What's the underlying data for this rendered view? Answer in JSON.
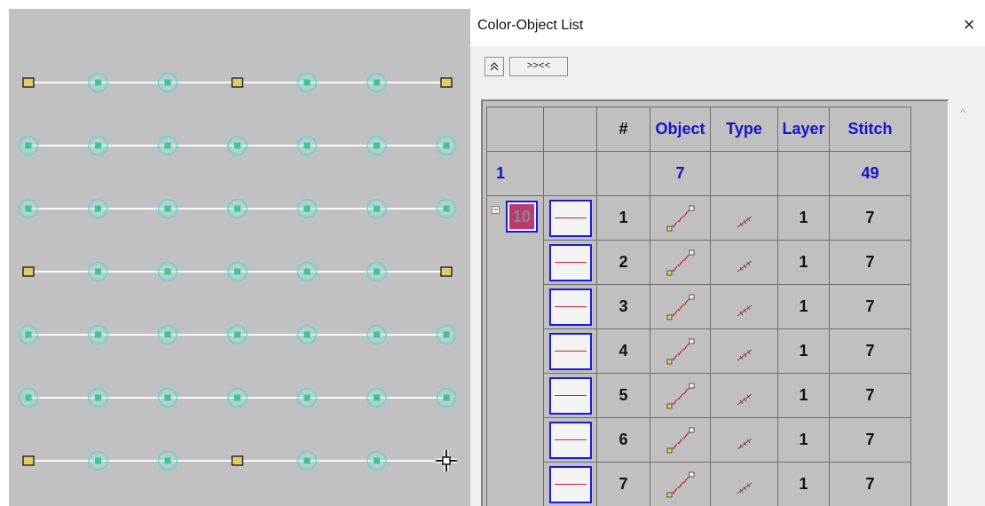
{
  "panel": {
    "title": "Color-Object List",
    "close_label": "×",
    "collapse_label": "≈",
    "expand_label": ">><<"
  },
  "table": {
    "headers": [
      "",
      "",
      "#",
      "Object",
      "Type",
      "Layer",
      "Stitch"
    ],
    "totals": {
      "color_count": "1",
      "object_count": "7",
      "stitch_total": "49"
    },
    "color_group": {
      "number": "10",
      "swatch_color": "#bd3a70",
      "line_color": "#d0203c"
    },
    "rows": [
      {
        "num": "1",
        "object_icon": "running-stitch-icon",
        "type_icon": "stitch-type-icon",
        "layer": "1",
        "stitch": "7"
      },
      {
        "num": "2",
        "object_icon": "running-stitch-icon",
        "type_icon": "stitch-type-icon",
        "layer": "1",
        "stitch": "7"
      },
      {
        "num": "3",
        "object_icon": "running-stitch-icon",
        "type_icon": "stitch-type-icon",
        "layer": "1",
        "stitch": "7"
      },
      {
        "num": "4",
        "object_icon": "running-stitch-icon",
        "type_icon": "stitch-type-icon",
        "layer": "1",
        "stitch": "7"
      },
      {
        "num": "5",
        "object_icon": "running-stitch-icon",
        "type_icon": "stitch-type-icon",
        "layer": "1",
        "stitch": "7"
      },
      {
        "num": "6",
        "object_icon": "running-stitch-icon",
        "type_icon": "stitch-type-icon",
        "layer": "1",
        "stitch": "7"
      },
      {
        "num": "7",
        "object_icon": "running-stitch-icon",
        "type_icon": "stitch-type-icon",
        "layer": "1",
        "stitch": "7"
      }
    ]
  },
  "canvas": {
    "background": "#c1c1c1",
    "line_color": "#ffffff",
    "node_ring_color": "#5ad8d8",
    "node_fill_color": "#3ac890",
    "corner_fill_color": "#e0cc6a",
    "rows": 7,
    "cols": 7,
    "square_nodes": [
      [
        0,
        0
      ],
      [
        0,
        3
      ],
      [
        0,
        6
      ],
      [
        3,
        0
      ],
      [
        3,
        6
      ],
      [
        6,
        0
      ],
      [
        6,
        3
      ]
    ],
    "cursor_icon": "move-cursor-icon"
  }
}
